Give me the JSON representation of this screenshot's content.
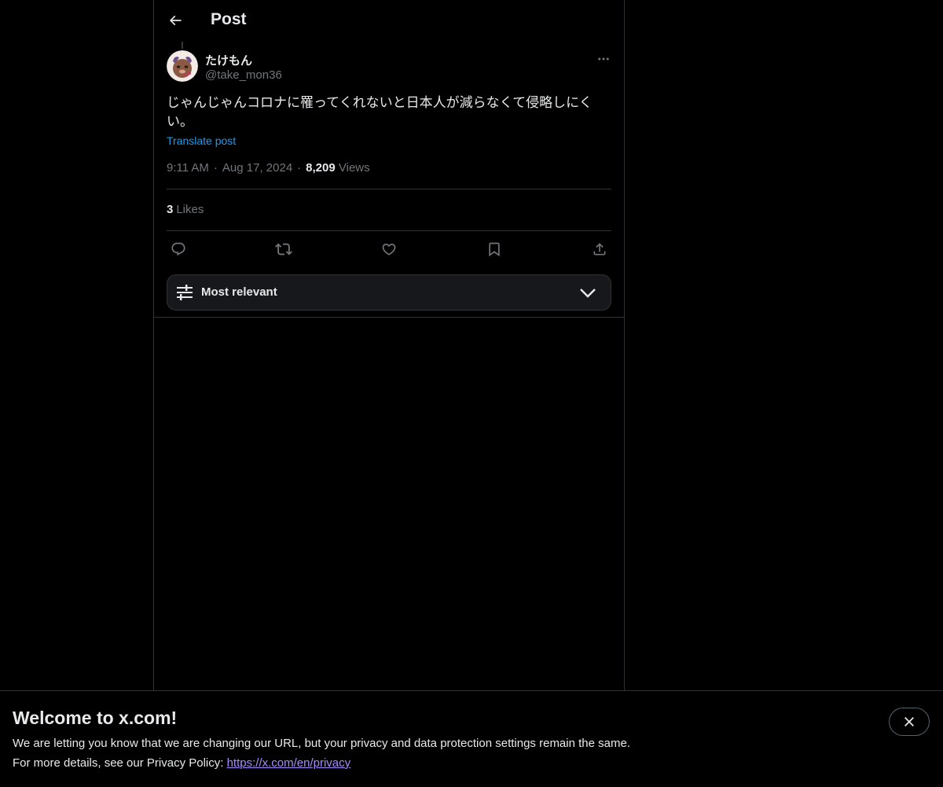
{
  "header": {
    "title": "Post",
    "back_icon": "arrow-left-icon"
  },
  "post": {
    "author_name": "たけもん",
    "author_handle": "@take_mon36",
    "text": "じゃんじゃんコロナに罹ってくれないと日本人が減らなくて侵略しにくい。",
    "translate_label": "Translate post",
    "time": "9:11 AM",
    "separator": "·",
    "date": "Aug 17, 2024",
    "views_count": "8,209",
    "views_label": "Views",
    "likes_count": "3",
    "likes_label": "Likes"
  },
  "actions": [
    "reply-icon",
    "repost-icon",
    "like-icon",
    "bookmark-icon",
    "share-icon"
  ],
  "sort": {
    "label": "Most relevant"
  },
  "banner": {
    "title": "Welcome to x.com!",
    "line1": "We are letting you know that we are changing our URL, but your privacy and data protection settings remain the same.",
    "line2_prefix": "For more details, see our Privacy Policy: ",
    "link": "https://x.com/en/privacy"
  },
  "colors": {
    "background": "#000000",
    "text": "#e7e9ea",
    "muted": "#71767b",
    "accent": "#1d9bf0",
    "border": "#2f3336"
  }
}
